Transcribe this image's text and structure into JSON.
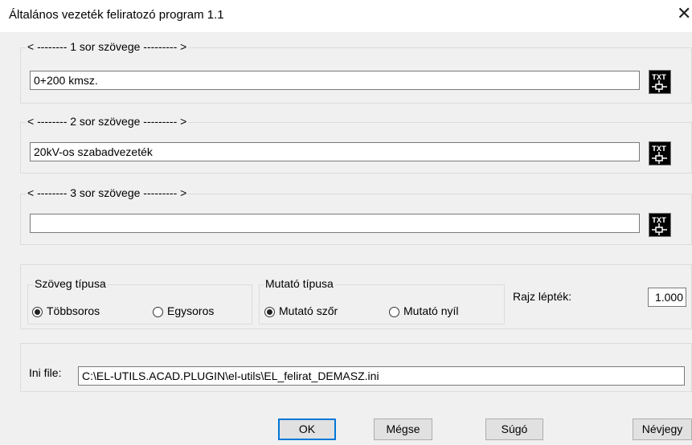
{
  "window": {
    "title": "Általános vezeték feliratozó program 1.1",
    "close_glyph": "✕"
  },
  "lines": [
    {
      "legend": "< -------- 1 sor szövege --------- >",
      "value": "0+200 kmsz.",
      "icon": "txt-pick-icon"
    },
    {
      "legend": "< -------- 2 sor szövege --------- >",
      "value": "20kV-os szabadvezeték",
      "icon": "txt-pick-icon"
    },
    {
      "legend": "< -------- 3 sor szövege --------- >",
      "value": "",
      "icon": "txt-pick-icon"
    }
  ],
  "text_type": {
    "legend": "Szöveg típusa",
    "options": [
      "Többsoros",
      "Egysoros"
    ],
    "selected": "Többsoros"
  },
  "pointer_type": {
    "legend": "Mutató típusa",
    "options": [
      "Mutató szőr",
      "Mutató nyíl"
    ],
    "selected": "Mutató szőr"
  },
  "scale": {
    "label": "Rajz lépték:",
    "value": "1.000"
  },
  "ini": {
    "label": "Ini file:",
    "value": "C:\\EL-UTILS.ACAD.PLUGIN\\el-utils\\EL_felirat_DEMASZ.ini"
  },
  "buttons": {
    "ok": "OK",
    "cancel": "Mégse",
    "help": "Súgó",
    "about": "Névjegy"
  },
  "colors": {
    "default_button_border": "#0078d7",
    "icon_bg": "#000000"
  }
}
